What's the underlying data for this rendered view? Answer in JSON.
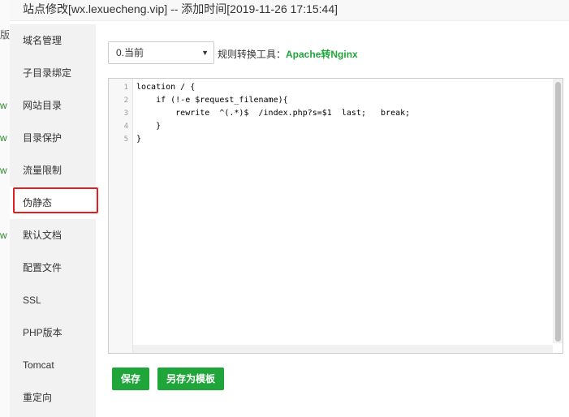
{
  "background": {
    "sliver_text": "版",
    "sliver_w_items": [
      "w",
      "w",
      "w",
      "w"
    ]
  },
  "dialog": {
    "title": "站点修改[wx.lexuecheng.vip] -- 添加时间[2019-11-26 17:15:44]"
  },
  "sidebar": {
    "items": [
      {
        "label": "域名管理"
      },
      {
        "label": "子目录绑定"
      },
      {
        "label": "网站目录"
      },
      {
        "label": "目录保护"
      },
      {
        "label": "流量限制"
      },
      {
        "label": "伪静态"
      },
      {
        "label": "默认文档"
      },
      {
        "label": "配置文件"
      },
      {
        "label": "SSL"
      },
      {
        "label": "PHP版本"
      },
      {
        "label": "Tomcat"
      },
      {
        "label": "重定向"
      }
    ],
    "active_index": 5
  },
  "rewrite": {
    "select_value": "0.当前",
    "tool_label": "规则转换工具：",
    "tool_link": "Apache转Nginx"
  },
  "editor": {
    "line_numbers": [
      "1",
      "2",
      "3",
      "4",
      "5"
    ],
    "lines": [
      "location / {",
      "    if (!-e $request_filename){",
      "        rewrite  ^(.*)$  /index.php?s=$1  last;   break;",
      "    }",
      "}"
    ]
  },
  "buttons": {
    "save": "保存",
    "save_as_template": "另存为模板"
  },
  "colors": {
    "accent": "#20a53a",
    "highlight": "#e02020"
  }
}
